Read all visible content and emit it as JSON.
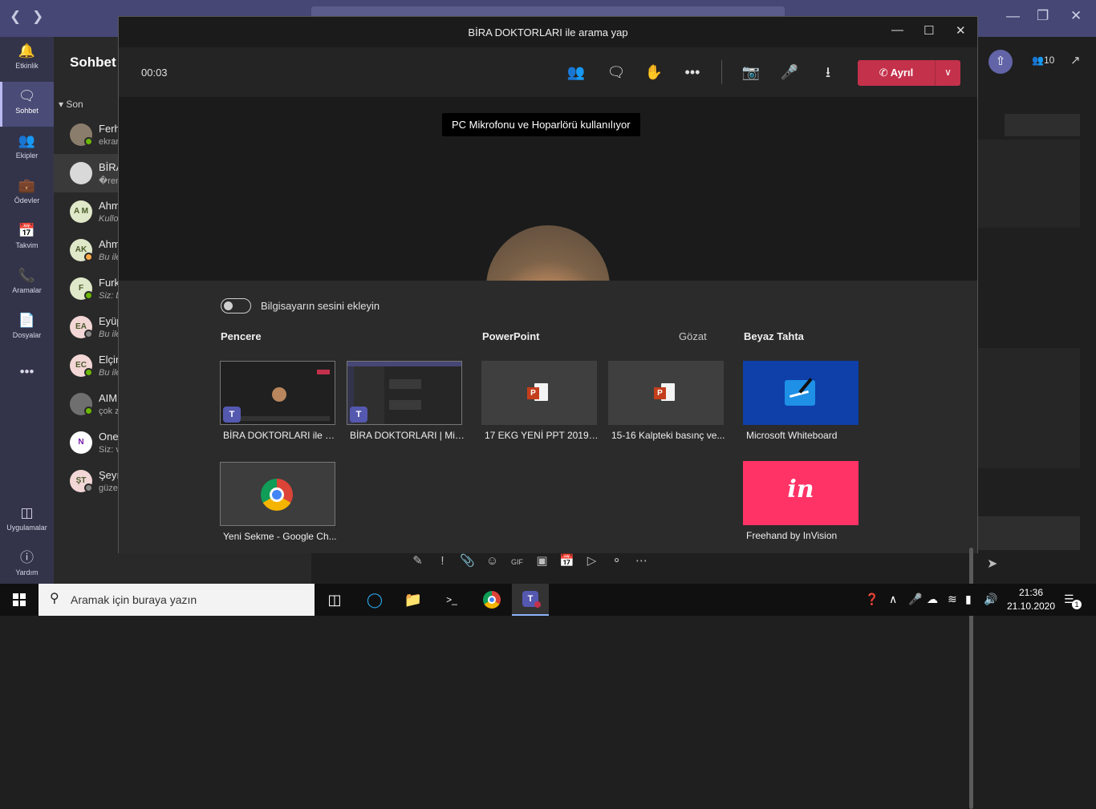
{
  "app": {
    "rail": [
      {
        "label": "Etkinlik",
        "icon": "bell-icon"
      },
      {
        "label": "Sohbet",
        "icon": "chat-icon"
      },
      {
        "label": "Ekipler",
        "icon": "teams-icon"
      },
      {
        "label": "Ödevler",
        "icon": "assignments-icon"
      },
      {
        "label": "Takvim",
        "icon": "calendar-icon"
      },
      {
        "label": "Aramalar",
        "icon": "phone-icon"
      },
      {
        "label": "Dosyalar",
        "icon": "file-icon"
      },
      {
        "label": "•••",
        "icon": "more-icon"
      },
      {
        "label": "Uygulamalar",
        "icon": "apps-icon"
      },
      {
        "label": "Yardım",
        "icon": "help-icon"
      }
    ],
    "chat_title": "Sohbet",
    "recent_label": "Son",
    "chats": [
      {
        "name": "Ferh",
        "preview": "ekrar",
        "initials": "",
        "avatar_color": "#8a7d6b",
        "status_color": "#6bb700"
      },
      {
        "name": "BİRA",
        "preview": "�ren",
        "initials": "",
        "avatar_color": "#d9d9d9",
        "status_color": ""
      },
      {
        "name": "Ahm",
        "preview": "Kullo",
        "initials": "A M",
        "avatar_color": "#dfe8c9",
        "status_color": ""
      },
      {
        "name": "Ahm",
        "preview": "Bu ile",
        "initials": "AK",
        "avatar_color": "#dfe8c9",
        "status_color": "#ffaa44"
      },
      {
        "name": "Furk",
        "preview": "Siz: b",
        "initials": "F",
        "avatar_color": "#dfe8c9",
        "status_color": "#6bb700"
      },
      {
        "name": "Eyüp",
        "preview": "Bu ile",
        "initials": "EA",
        "avatar_color": "#f3d6d6",
        "status_color": "#8a8886"
      },
      {
        "name": "Elçin",
        "preview": "Bu ile",
        "initials": "EC",
        "avatar_color": "#f3d6d6",
        "status_color": "#6bb700"
      },
      {
        "name": "AIM",
        "preview": "çok z",
        "initials": "",
        "avatar_color": "#6f6f6f",
        "status_color": "#6bb700"
      },
      {
        "name": "One",
        "preview": "Siz: v",
        "initials": "N",
        "avatar_color": "#ffffff",
        "status_color": ""
      },
      {
        "name": "Şeyı",
        "preview": "güze",
        "initials": "ŞT",
        "avatar_color": "#f3d6d6",
        "status_color": "#8a8886"
      }
    ],
    "composer_icons": [
      "format-icon",
      "important-icon",
      "attach-icon",
      "emoji-icon",
      "gif-icon",
      "sticker-icon",
      "meeting-icon",
      "stream-icon",
      "praise-icon",
      "more-icon"
    ],
    "right_count": "10"
  },
  "call": {
    "title": "BİRA DOKTORLARI ile arama yap",
    "timer": "00:03",
    "leave_label": "Ayrıl",
    "audio_tooltip": "PC Mikrofonu ve Hoparlörü kullanılıyor",
    "share": {
      "computer_audio_label": "Bilgisayarın sesini ekleyin",
      "computer_audio_on": false,
      "section_window": "Pencere",
      "section_powerpoint": "PowerPoint",
      "browse_label": "Gözat",
      "section_whiteboard": "Beyaz Tahta",
      "windows": [
        "BİRA DOKTORLARI ile ar...",
        "BİRA DOKTORLARI | Mic...",
        "Yeni Sekme - Google Ch..."
      ],
      "powerpoints": [
        "17 EKG YENİ PPT 2019 (1...",
        "15-16 Kalpteki basınç ve..."
      ],
      "whiteboards": [
        "Microsoft Whiteboard",
        "Freehand by InVision"
      ]
    }
  },
  "taskbar": {
    "search_placeholder": "Aramak için buraya yazın",
    "time": "21:36",
    "date": "21.10.2020",
    "notification_count": "1"
  }
}
